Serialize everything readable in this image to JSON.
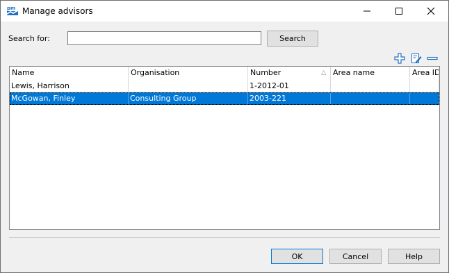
{
  "window": {
    "title": "Manage advisors",
    "app_icon": "pm-logo-icon"
  },
  "search": {
    "label": "Search for:",
    "value": "",
    "placeholder": "",
    "button_label": "Search"
  },
  "toolbar": {
    "add_icon": "plus-icon",
    "edit_icon": "edit-icon",
    "remove_icon": "minus-icon"
  },
  "table": {
    "columns": [
      "Name",
      "Organisation",
      "Number",
      "Area name",
      "Area ID"
    ],
    "sorted_column": "Number",
    "rows": [
      {
        "name": "Lewis, Harrison",
        "organisation": "",
        "number": "1-2012-01",
        "area_name": "",
        "area_id": ""
      },
      {
        "name": "McGowan, Finley",
        "organisation": "Consulting Group",
        "number": "2003-221",
        "area_name": "",
        "area_id": "",
        "selected": true
      }
    ]
  },
  "buttons": {
    "ok": "OK",
    "cancel": "Cancel",
    "help": "Help"
  },
  "colors": {
    "selection": "#0078d7",
    "accent_icon": "#1f6fc5"
  }
}
